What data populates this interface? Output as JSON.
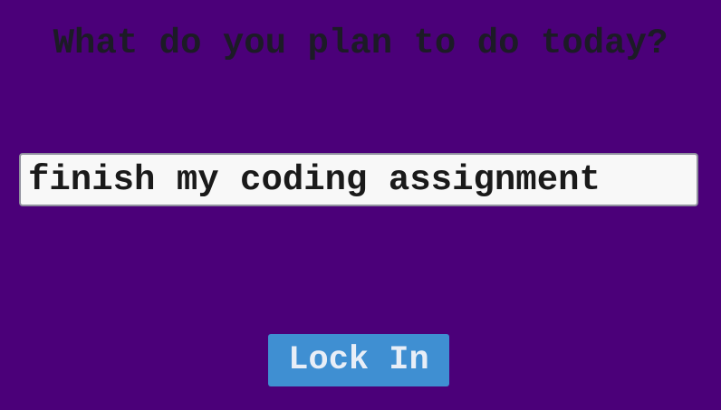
{
  "colors": {
    "background": "#4b0079",
    "heading_text": "#1c1b26",
    "input_background": "#f8f8f8",
    "input_text": "#1a1a1a",
    "button_background": "#3f8fd2",
    "button_text": "#e8eef7"
  },
  "prompt": {
    "heading": "What do you plan to do today?"
  },
  "task_input": {
    "value": "finish my coding assignment",
    "placeholder": ""
  },
  "lock_button": {
    "label": "Lock In"
  }
}
